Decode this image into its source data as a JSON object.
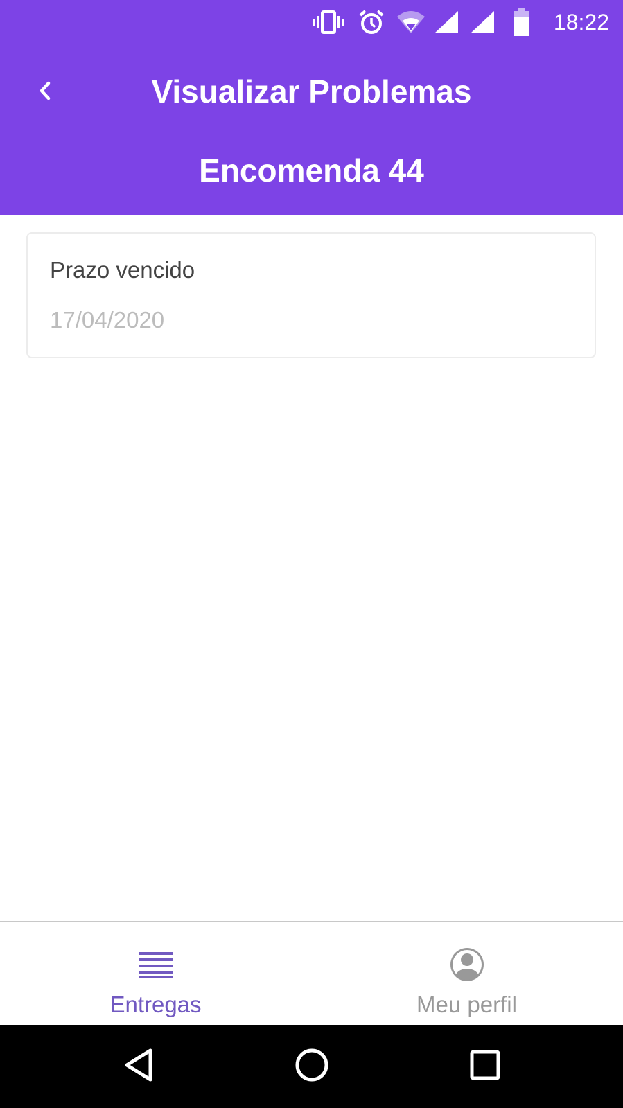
{
  "status_bar": {
    "time": "18:22",
    "icons": [
      "vibrate-icon",
      "alarm-icon",
      "wifi-icon",
      "signal-icon",
      "signal-icon",
      "battery-icon"
    ]
  },
  "header": {
    "title": "Visualizar Problemas",
    "subtitle": "Encomenda 44",
    "back_icon": "chevron-left-icon"
  },
  "problems": [
    {
      "description": "Prazo vencido",
      "date": "17/04/2020"
    }
  ],
  "bottom_nav": {
    "tabs": [
      {
        "label": "Entregas",
        "icon": "list-icon",
        "active": true
      },
      {
        "label": "Meu perfil",
        "icon": "user-circle-icon",
        "active": false
      }
    ],
    "active_color": "#7159c1",
    "inactive_color": "#999999"
  },
  "colors": {
    "primary": "#7d43e6",
    "card_border": "#ececec",
    "text_primary": "#444444",
    "text_secondary": "#bcbcbc"
  },
  "system_nav": {
    "buttons": [
      "back-triangle-icon",
      "home-circle-icon",
      "recents-square-icon"
    ]
  }
}
